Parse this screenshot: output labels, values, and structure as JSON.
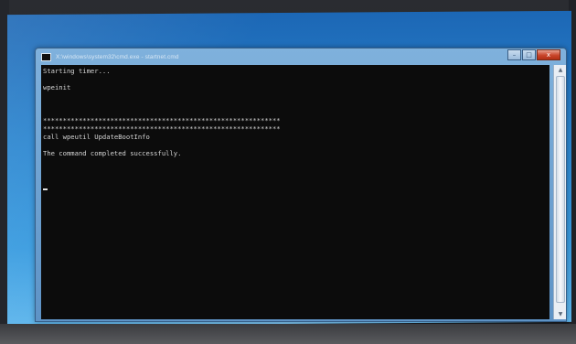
{
  "window": {
    "title": "X:\\windows\\system32\\cmd.exe - startnet.cmd",
    "icon": "console-icon",
    "controls": {
      "minimize": "–",
      "maximize": "□",
      "close": "x"
    }
  },
  "console": {
    "lines": [
      "Starting timer...",
      "",
      "wpeinit",
      "",
      "",
      "",
      "************************************************************",
      "************************************************************",
      "call wpeutil UpdateBootInfo",
      "",
      "The command completed successfully.",
      "",
      "",
      ""
    ]
  },
  "colors": {
    "console_background": "#0c0c0c",
    "console_text": "#d4d4d4",
    "close_button": "#c8442a",
    "desktop": "#2b85cf"
  }
}
